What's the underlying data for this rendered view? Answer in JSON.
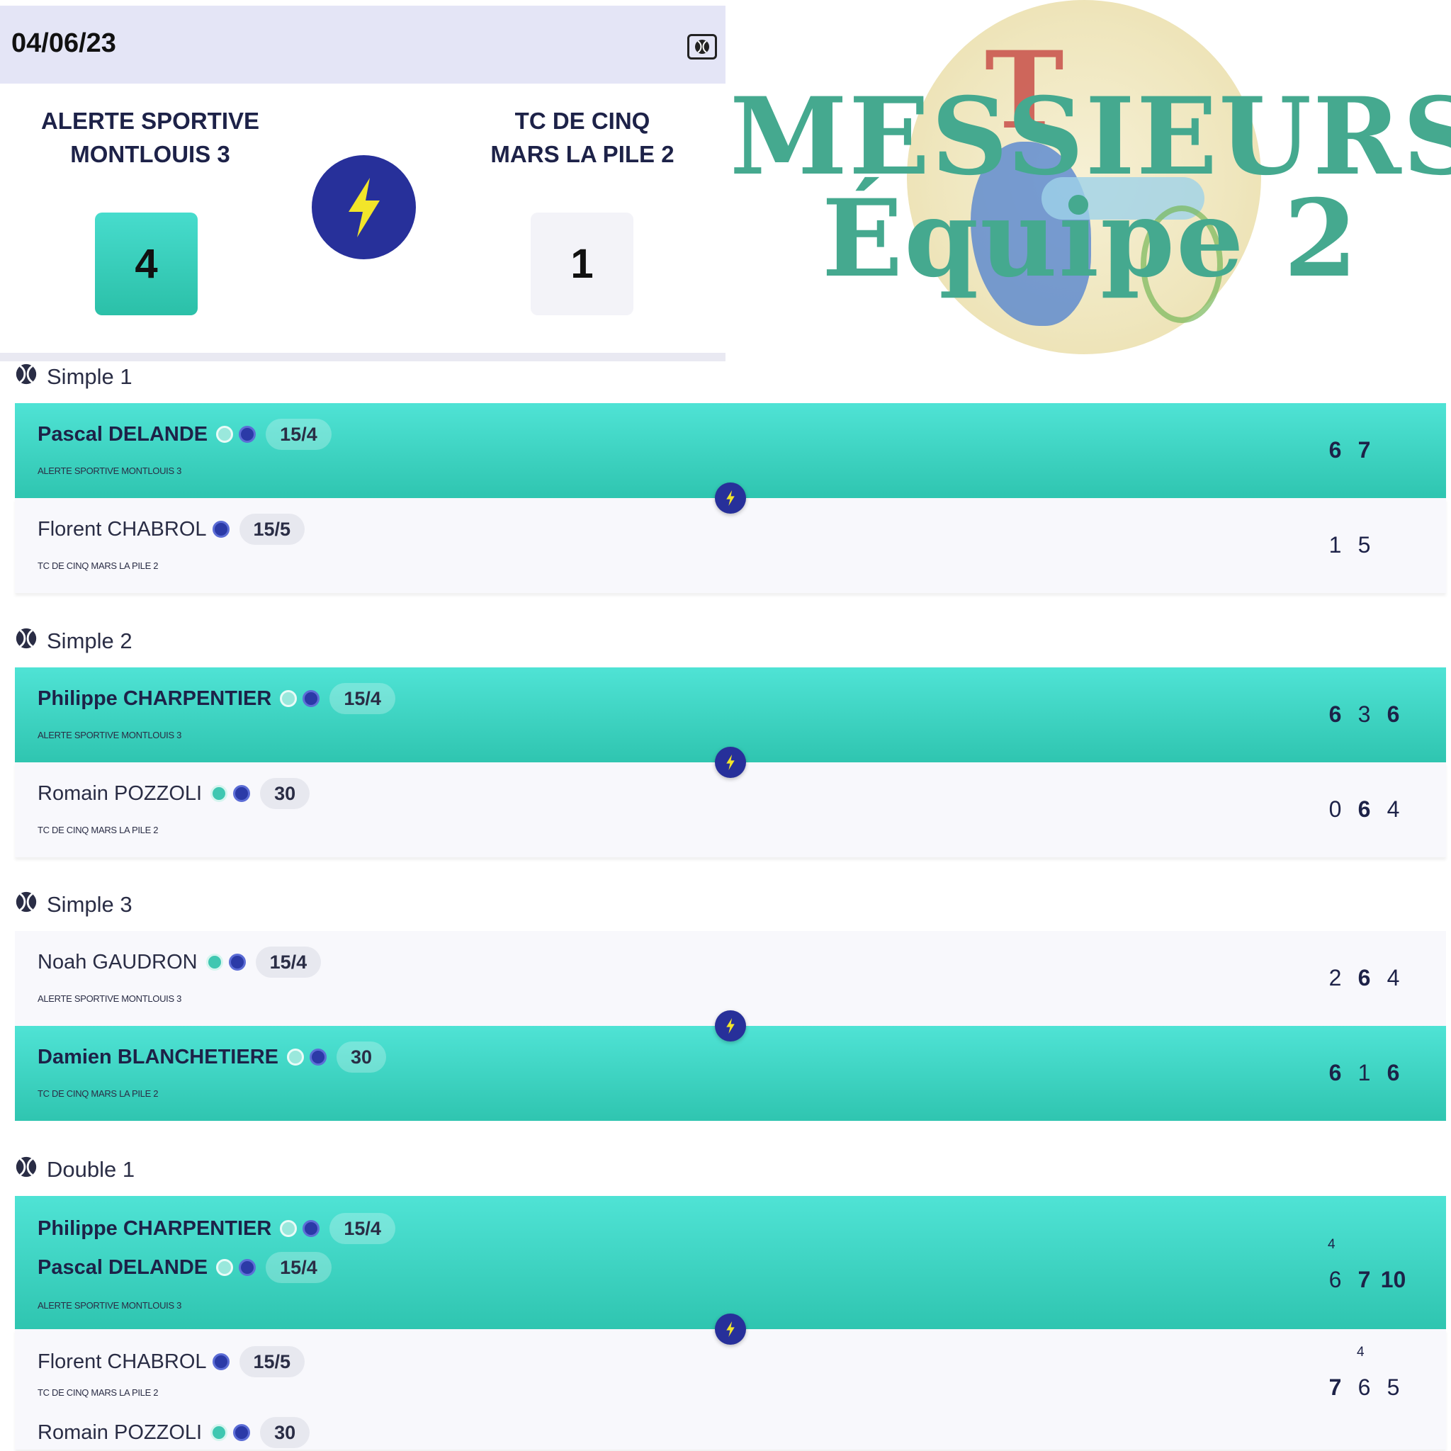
{
  "header": {
    "date": "04/06/23"
  },
  "match": {
    "home_team_line1": "ALERTE SPORTIVE",
    "home_team_line2": "MONTLOUIS 3",
    "away_team_line1": "TC DE CINQ",
    "away_team_line2": "MARS LA PILE 2",
    "home_score": "4",
    "away_score": "1"
  },
  "banner": {
    "line1": "MESSIEURS",
    "line2": "Équipe 2"
  },
  "icons": {
    "ball": "tennis-ball-icon",
    "bolt": "lightning-bolt-icon",
    "ranking_green": "green-badge-icon",
    "ranking_blue": "blue-badge-icon"
  },
  "colors": {
    "win_row": "#2fc5b0",
    "navy": "#27309a",
    "bolt": "#f2e52a",
    "title": "#45a98f",
    "header_bg": "#e4e5f6"
  },
  "matches": [
    {
      "title": "Simple 1",
      "top": {
        "winner": true,
        "players": [
          {
            "name": "Pascal DELANDE",
            "rank": "15/4"
          }
        ],
        "club": "ALERTE SPORTIVE MONTLOUIS 3",
        "sets": [
          "6",
          "7"
        ]
      },
      "bottom": {
        "winner": false,
        "players": [
          {
            "name": "Florent CHABROL",
            "rank": "15/5"
          }
        ],
        "club": "TC DE CINQ MARS LA PILE 2",
        "sets": [
          "1",
          "5"
        ]
      }
    },
    {
      "title": "Simple 2",
      "top": {
        "winner": true,
        "players": [
          {
            "name": "Philippe CHARPENTIER",
            "rank": "15/4"
          }
        ],
        "club": "ALERTE SPORTIVE MONTLOUIS 3",
        "sets": [
          "6",
          "3",
          "6"
        ]
      },
      "bottom": {
        "winner": false,
        "players": [
          {
            "name": "Romain POZZOLI",
            "rank": "30"
          }
        ],
        "club": "TC DE CINQ MARS LA PILE 2",
        "sets": [
          "0",
          "6",
          "4"
        ]
      }
    },
    {
      "title": "Simple 3",
      "top": {
        "winner": false,
        "players": [
          {
            "name": "Noah GAUDRON",
            "rank": "15/4"
          }
        ],
        "club": "ALERTE SPORTIVE MONTLOUIS 3",
        "sets": [
          "2",
          "6",
          "4"
        ]
      },
      "bottom": {
        "winner": true,
        "players": [
          {
            "name": "Damien BLANCHETIERE",
            "rank": "30"
          }
        ],
        "club": "TC DE CINQ MARS LA PILE 2",
        "sets": [
          "6",
          "1",
          "6"
        ]
      }
    },
    {
      "title": "Double 1",
      "top": {
        "winner": true,
        "players": [
          {
            "name": "Philippe CHARPENTIER",
            "rank": "15/4"
          },
          {
            "name": "Pascal DELANDE",
            "rank": "15/4"
          }
        ],
        "club": "ALERTE SPORTIVE MONTLOUIS 3",
        "sets": [
          "6",
          "7",
          "10"
        ],
        "tiebreak": "4"
      },
      "bottom": {
        "winner": false,
        "players": [
          {
            "name": "Florent CHABROL",
            "rank": "15/5"
          },
          {
            "name": "Romain POZZOLI",
            "rank": "30"
          }
        ],
        "club": "TC DE CINQ MARS LA PILE 2",
        "sets": [
          "7",
          "6",
          "5"
        ],
        "tiebreak": "4"
      }
    }
  ]
}
